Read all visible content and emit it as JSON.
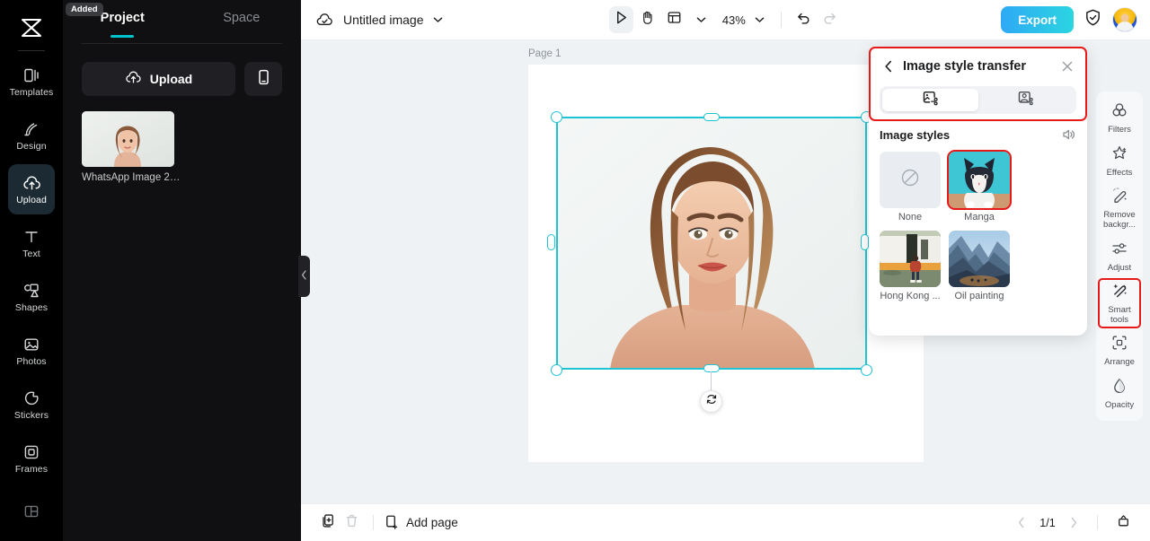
{
  "app": {
    "logo_icon": "capcut-logo-icon",
    "accent_color": "#00c4cc",
    "highlight_color": "#e81919",
    "selection_color": "#1fc4d4"
  },
  "rail": {
    "items": [
      {
        "label": "Templates",
        "icon": "templates-icon",
        "active": false
      },
      {
        "label": "Design",
        "icon": "design-icon",
        "active": false
      },
      {
        "label": "Upload",
        "icon": "upload-cloud-icon",
        "active": true
      },
      {
        "label": "Text",
        "icon": "text-icon",
        "active": false
      },
      {
        "label": "Shapes",
        "icon": "shapes-icon",
        "active": false
      },
      {
        "label": "Photos",
        "icon": "photos-icon",
        "active": false
      },
      {
        "label": "Stickers",
        "icon": "stickers-icon",
        "active": false
      },
      {
        "label": "Frames",
        "icon": "frames-icon",
        "active": false
      },
      {
        "label": "",
        "icon": "layout-icon",
        "active": false
      }
    ]
  },
  "panel": {
    "tabs": [
      {
        "label": "Project",
        "active": true
      },
      {
        "label": "Space",
        "active": false
      }
    ],
    "upload_label": "Upload",
    "upload_icon": "upload-cloud-icon",
    "mobile_icon": "mobile-phone-icon",
    "assets": [
      {
        "badge": "Added",
        "name": "WhatsApp Image 20..."
      }
    ],
    "collapse_icon": "chevron-left-icon"
  },
  "topbar": {
    "cloud_icon": "cloud-saved-icon",
    "doc_title": "Untitled image",
    "caret_icon": "chevron-down-icon",
    "tools": [
      {
        "name": "select-tool",
        "icon": "cursor-arrow-icon",
        "selected": true
      },
      {
        "name": "hand-tool",
        "icon": "hand-icon",
        "selected": false
      },
      {
        "name": "layout-tool",
        "icon": "layout-grid-icon",
        "selected": false
      }
    ],
    "layout_caret_icon": "chevron-down-icon",
    "zoom_value": "43%",
    "zoom_caret_icon": "chevron-down-icon",
    "undo_icon": "undo-icon",
    "redo_icon": "redo-icon",
    "export_label": "Export",
    "shield_icon": "shield-check-icon",
    "avatar_icon": "user-avatar"
  },
  "canvas": {
    "page_label": "Page 1",
    "float_toolbar": [
      {
        "name": "duplicate-button",
        "icon": "duplicate-icon"
      },
      {
        "name": "more-options-button",
        "icon": "ellipsis-icon"
      }
    ],
    "rotate_icon": "rotate-icon"
  },
  "style_panel": {
    "back_icon": "chevron-left-icon",
    "title": "Image style transfer",
    "close_icon": "close-icon",
    "tabs": [
      {
        "name": "image-style-tab",
        "icon": "image-style-icon",
        "active": true
      },
      {
        "name": "portrait-style-tab",
        "icon": "portrait-style-icon",
        "active": false
      }
    ],
    "section_title": "Image styles",
    "sound_icon": "sound-icon",
    "styles": [
      {
        "label": "None",
        "icon": "none-forbidden-icon",
        "selected": false,
        "kind": "none"
      },
      {
        "label": "Manga",
        "selected": true,
        "kind": "cat"
      },
      {
        "label": "Hong Kong ...",
        "selected": false,
        "kind": "van"
      },
      {
        "label": "Oil painting",
        "selected": false,
        "kind": "oil"
      }
    ]
  },
  "tool_rail": {
    "tools": [
      {
        "label": "Filters",
        "icon": "filters-icon",
        "highlighted": false
      },
      {
        "label": "Effects",
        "icon": "effects-icon",
        "highlighted": false
      },
      {
        "label": "Remove backgr...",
        "icon": "remove-background-icon",
        "highlighted": false
      },
      {
        "label": "Adjust",
        "icon": "adjust-sliders-icon",
        "highlighted": false
      },
      {
        "label": "Smart tools",
        "icon": "smart-tools-wand-icon",
        "highlighted": true
      },
      {
        "label": "Arrange",
        "icon": "arrange-icon",
        "highlighted": false
      },
      {
        "label": "Opacity",
        "icon": "opacity-drop-icon",
        "highlighted": false
      }
    ]
  },
  "bottombar": {
    "duplicate_page_icon": "duplicate-page-icon",
    "delete_page_icon": "trash-icon",
    "add_page_icon": "add-page-icon",
    "add_page_label": "Add page",
    "prev_icon": "chevron-left-icon",
    "page_indicator": "1/1",
    "next_icon": "chevron-right-icon",
    "fullscreen_icon": "expand-icon"
  }
}
